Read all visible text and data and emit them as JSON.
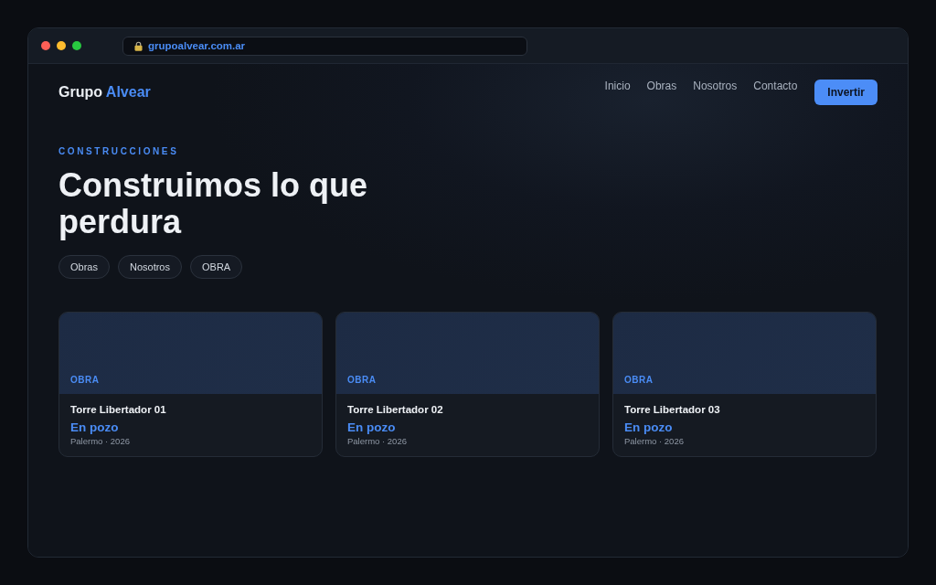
{
  "browser": {
    "url": "grupoalvear.com.ar"
  },
  "header": {
    "logo": {
      "primary": "Grupo",
      "accent": "Alvear"
    },
    "nav": [
      "Inicio",
      "Obras",
      "Nosotros",
      "Contacto"
    ],
    "cta": "Invertir"
  },
  "hero": {
    "eyebrow": "CONSTRUCCIONES",
    "title": "Construimos lo que perdura",
    "chips": [
      "Obras",
      "Nosotros",
      "OBRA"
    ]
  },
  "projects": [
    {
      "tag": "OBRA",
      "name": "Torre Libertador 01",
      "status": "En pozo",
      "meta": "Palermo · 2026"
    },
    {
      "tag": "OBRA",
      "name": "Torre Libertador 02",
      "status": "En pozo",
      "meta": "Palermo · 2026"
    },
    {
      "tag": "OBRA",
      "name": "Torre Libertador 03",
      "status": "En pozo",
      "meta": "Palermo · 2026"
    }
  ]
}
